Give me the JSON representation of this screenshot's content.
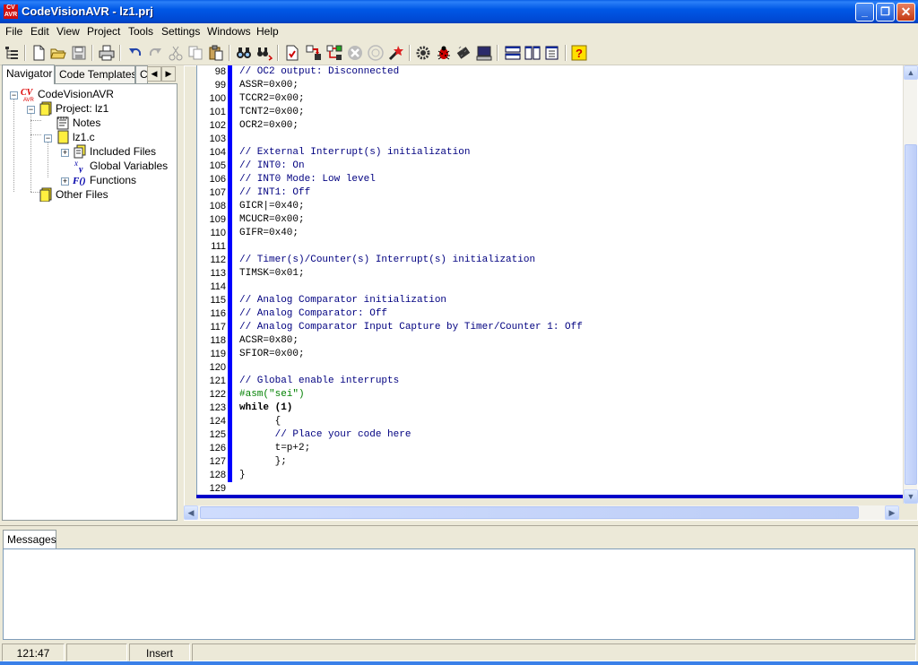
{
  "window": {
    "title": "CodeVisionAVR - lz1.prj",
    "logo_text": "CV AVR",
    "min_label": "_",
    "max_label": "❐",
    "close_label": "✕"
  },
  "menu": [
    "File",
    "Edit",
    "View",
    "Project",
    "Tools",
    "Settings",
    "Windows",
    "Help"
  ],
  "toolbar": {
    "icons": [
      "tree-view-icon",
      "new-file-icon",
      "open-folder-icon",
      "save-icon",
      "print-icon",
      "undo-icon",
      "redo-icon",
      "cut-icon",
      "copy-icon",
      "paste-icon",
      "find-icon",
      "replace-icon",
      "check-syntax-icon",
      "compile-icon",
      "make-icon",
      "stop-icon",
      "program-chip-icon",
      "wizard-icon",
      "settings-gear-icon",
      "debugger-bug-icon",
      "chip-programmer-icon",
      "terminal-icon",
      "tile-horizontal-icon",
      "tile-vertical-icon",
      "cascade-icon",
      "help-icon"
    ]
  },
  "navigator": {
    "tabs": [
      "Navigator",
      "Code Templates",
      "C"
    ],
    "tab_left_arrow": "◀",
    "tab_right_arrow": "▶",
    "tree": {
      "root": "CodeVisionAVR",
      "project": "Project: lz1",
      "notes": "Notes",
      "file": "lz1.c",
      "included_files": "Included Files",
      "global_variables": "Global Variables",
      "functions": "Functions",
      "other_files": "Other Files"
    }
  },
  "editor": {
    "lines": [
      {
        "n": "98",
        "text": "// OC2 output: Disconnected",
        "cls": "cmt"
      },
      {
        "n": "99",
        "text": "ASSR=0x00;",
        "cls": ""
      },
      {
        "n": "100",
        "text": "TCCR2=0x00;",
        "cls": ""
      },
      {
        "n": "101",
        "text": "TCNT2=0x00;",
        "cls": ""
      },
      {
        "n": "102",
        "text": "OCR2=0x00;",
        "cls": ""
      },
      {
        "n": "103",
        "text": "",
        "cls": ""
      },
      {
        "n": "104",
        "text": "// External Interrupt(s) initialization",
        "cls": "cmt"
      },
      {
        "n": "105",
        "text": "// INT0: On",
        "cls": "cmt"
      },
      {
        "n": "106",
        "text": "// INT0 Mode: Low level",
        "cls": "cmt"
      },
      {
        "n": "107",
        "text": "// INT1: Off",
        "cls": "cmt"
      },
      {
        "n": "108",
        "text": "GICR|=0x40;",
        "cls": ""
      },
      {
        "n": "109",
        "text": "MCUCR=0x00;",
        "cls": ""
      },
      {
        "n": "110",
        "text": "GIFR=0x40;",
        "cls": ""
      },
      {
        "n": "111",
        "text": "",
        "cls": ""
      },
      {
        "n": "112",
        "text": "// Timer(s)/Counter(s) Interrupt(s) initialization",
        "cls": "cmt"
      },
      {
        "n": "113",
        "text": "TIMSK=0x01;",
        "cls": ""
      },
      {
        "n": "114",
        "text": "",
        "cls": ""
      },
      {
        "n": "115",
        "text": "// Analog Comparator initialization",
        "cls": "cmt"
      },
      {
        "n": "116",
        "text": "// Analog Comparator: Off",
        "cls": "cmt"
      },
      {
        "n": "117",
        "text": "// Analog Comparator Input Capture by Timer/Counter 1: Off",
        "cls": "cmt"
      },
      {
        "n": "118",
        "text": "ACSR=0x80;",
        "cls": ""
      },
      {
        "n": "119",
        "text": "SFIOR=0x00;",
        "cls": ""
      },
      {
        "n": "120",
        "text": "",
        "cls": ""
      },
      {
        "n": "121",
        "text": "// Global enable interrupts",
        "cls": "cmt"
      },
      {
        "n": "122",
        "text": "#asm(\"sei\")",
        "cls": "dir"
      },
      {
        "n": "123",
        "text": "while (1)",
        "cls": "kw"
      },
      {
        "n": "124",
        "text": "      {",
        "cls": ""
      },
      {
        "n": "125",
        "text": "      // Place your code here",
        "cls": "cmt"
      },
      {
        "n": "126",
        "text": "      t=p+2;",
        "cls": ""
      },
      {
        "n": "127",
        "text": "      };",
        "cls": ""
      },
      {
        "n": "128",
        "text": "}",
        "cls": ""
      },
      {
        "n": "129",
        "text": "",
        "cls": ""
      }
    ]
  },
  "messages": {
    "tab_label": "Messages"
  },
  "status": {
    "position": "121:47",
    "mode": "Insert"
  }
}
